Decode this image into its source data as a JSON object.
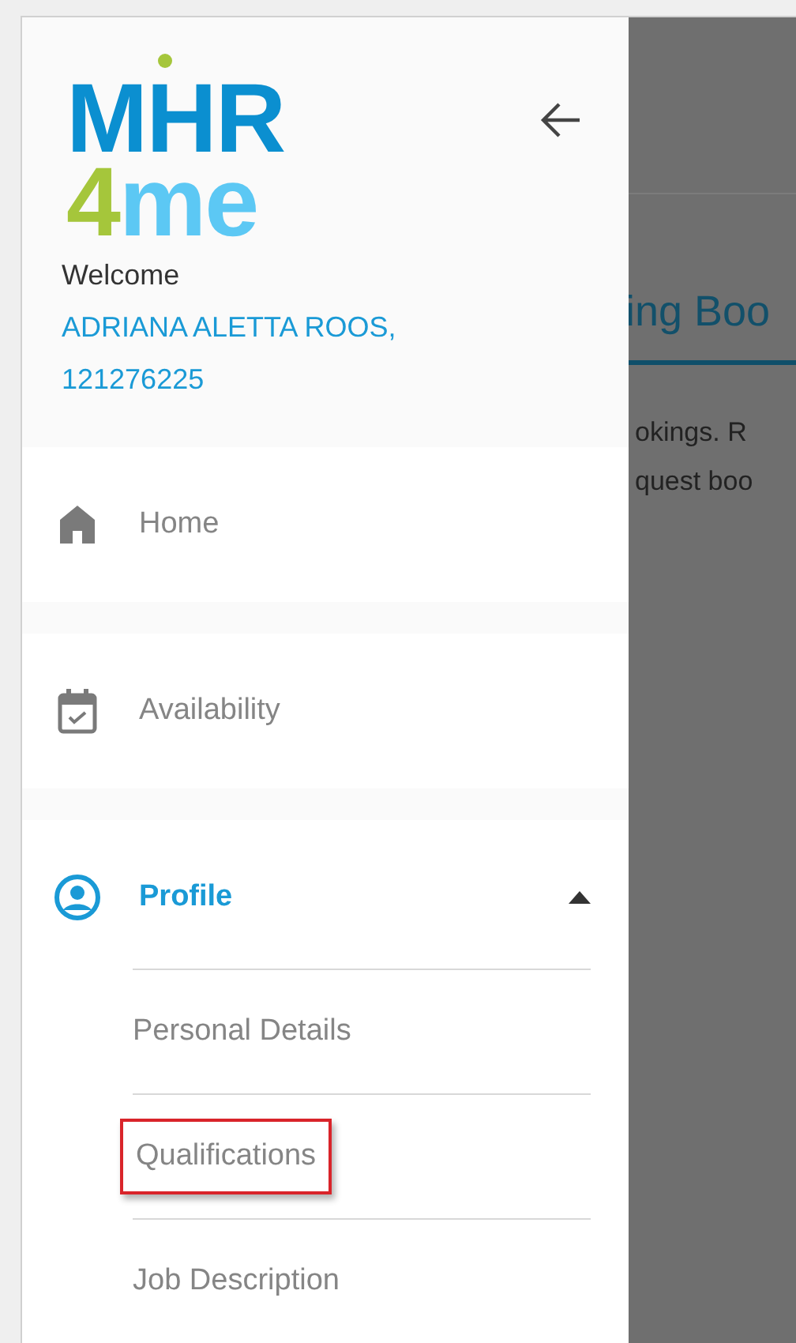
{
  "logo": {
    "top": "MHR",
    "digit": "4",
    "bottom": "me"
  },
  "welcome": {
    "greeting": "Welcome",
    "name": "ADRIANA ALETTA ROOS,",
    "number": "121276225"
  },
  "nav": [
    {
      "kind": "home",
      "label": "Home",
      "selected": false
    },
    {
      "kind": "calendar",
      "label": "Availability",
      "selected": false
    },
    {
      "kind": "profile",
      "label": "Profile",
      "selected": true,
      "expanded": true,
      "children": [
        {
          "label": "Personal Details",
          "highlighted": false
        },
        {
          "label": "Qualifications",
          "highlighted": true
        },
        {
          "label": "Job Description",
          "highlighted": false
        }
      ]
    }
  ],
  "background_page": {
    "tab_title": "ing Boo",
    "text_lines": [
      "okings. R",
      "quest boo"
    ]
  }
}
